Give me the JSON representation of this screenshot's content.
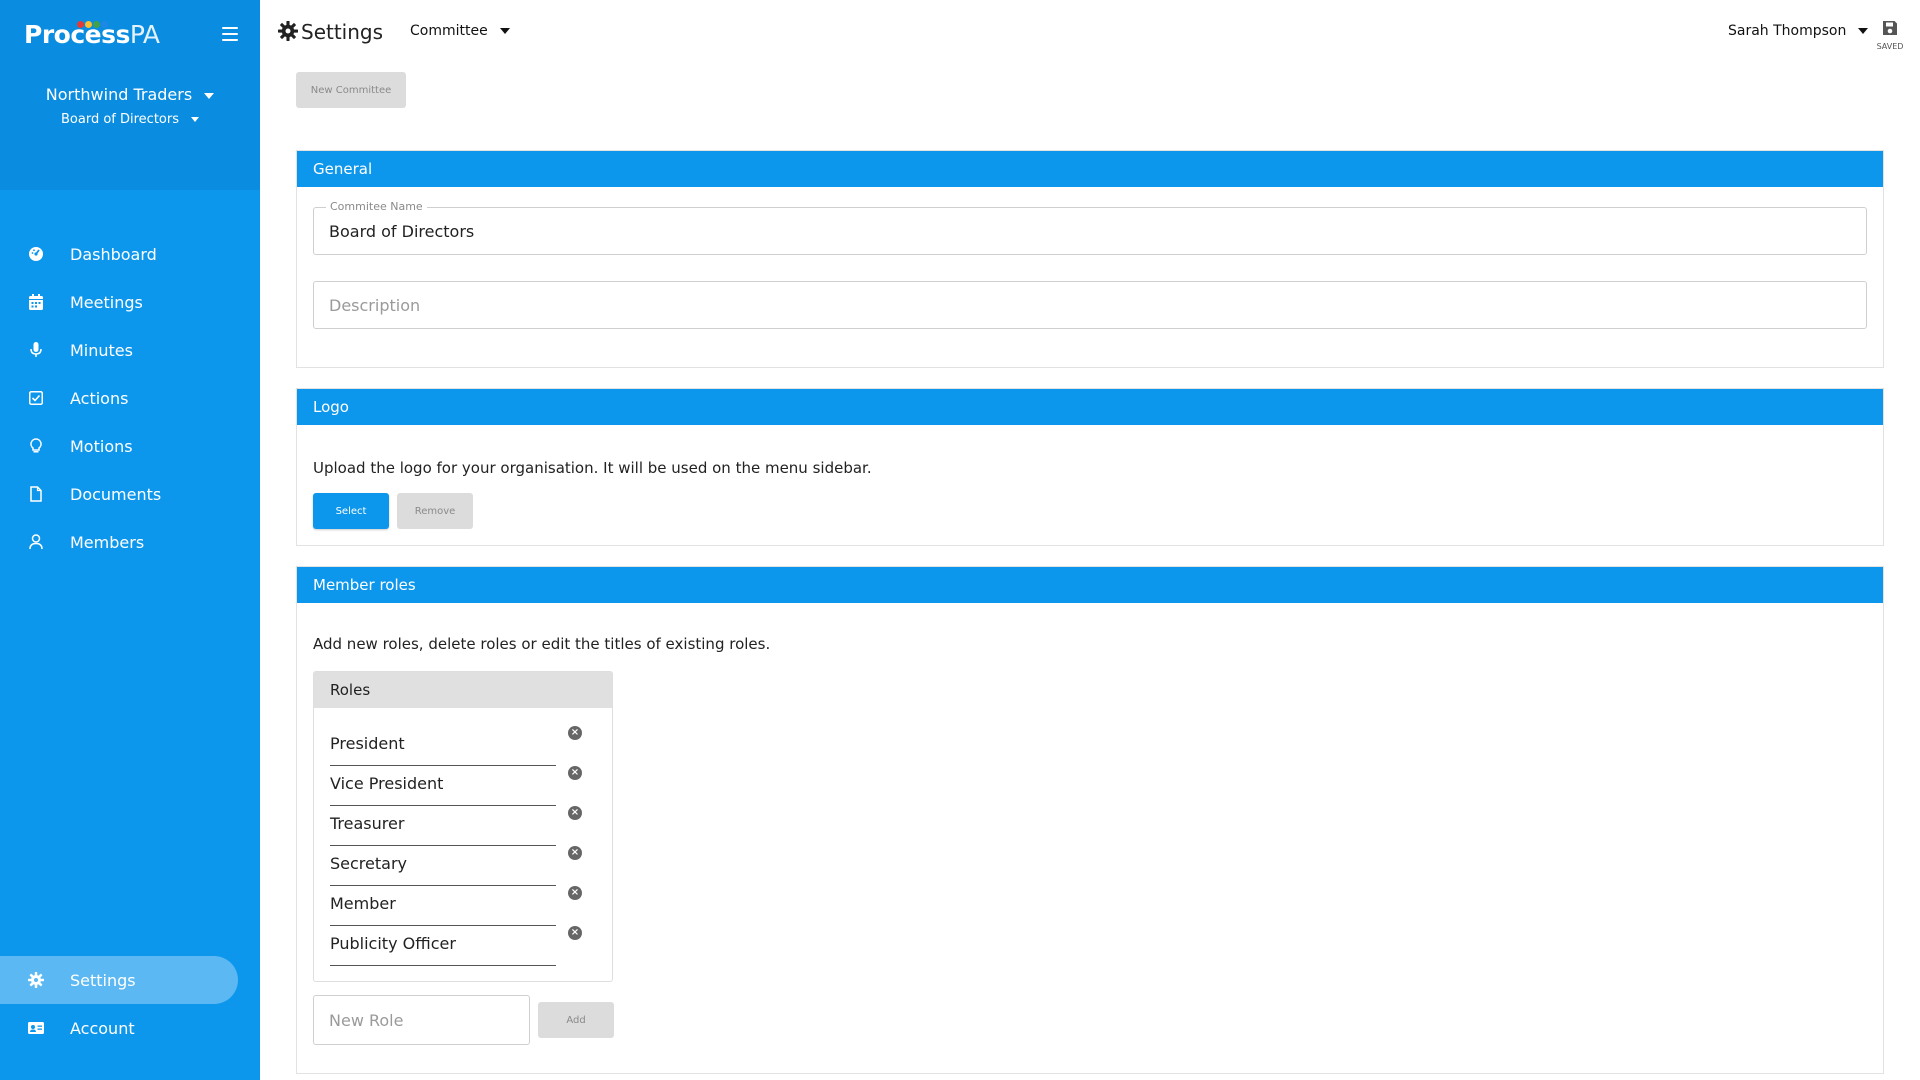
{
  "brand": {
    "logo_main": "Process",
    "logo_accent": "PA",
    "dot_colors": [
      "#e53935",
      "#fbc02d",
      "#43a047",
      "#1e88e5"
    ]
  },
  "sidebar": {
    "organization": "Northwind Traders",
    "committee": "Board of Directors",
    "items": [
      {
        "label": "Dashboard",
        "icon": "dashboard-icon"
      },
      {
        "label": "Meetings",
        "icon": "calendar-icon"
      },
      {
        "label": "Minutes",
        "icon": "microphone-icon"
      },
      {
        "label": "Actions",
        "icon": "checkbox-icon"
      },
      {
        "label": "Motions",
        "icon": "lightbulb-icon"
      },
      {
        "label": "Documents",
        "icon": "document-icon"
      },
      {
        "label": "Members",
        "icon": "user-icon"
      }
    ],
    "bottom_items": [
      {
        "label": "Settings",
        "icon": "gear-icon",
        "active": true
      },
      {
        "label": "Account",
        "icon": "id-card-icon"
      }
    ]
  },
  "topbar": {
    "title": "Settings",
    "section_select": "Committee",
    "user_name": "Sarah Thompson",
    "save_status": "SAVED"
  },
  "toolbar": {
    "new_committee_label": "New Committee"
  },
  "general": {
    "heading": "General",
    "name_label": "Commitee Name",
    "name_value": "Board of Directors",
    "description_placeholder": "Description"
  },
  "logo_section": {
    "heading": "Logo",
    "text": "Upload the logo for your organisation. It will be used on the menu sidebar.",
    "select_label": "Select",
    "remove_label": "Remove"
  },
  "member_roles": {
    "heading": "Member roles",
    "text": "Add new roles, delete roles or edit the titles of existing roles.",
    "roles_header": "Roles",
    "roles": [
      "President",
      "Vice President",
      "Treasurer",
      "Secretary",
      "Member",
      "Publicity Officer"
    ],
    "new_role_placeholder": "New Role",
    "add_label": "Add"
  },
  "colors": {
    "accent": "#0d97ec",
    "sidebar_active": "#5bb8f3"
  }
}
